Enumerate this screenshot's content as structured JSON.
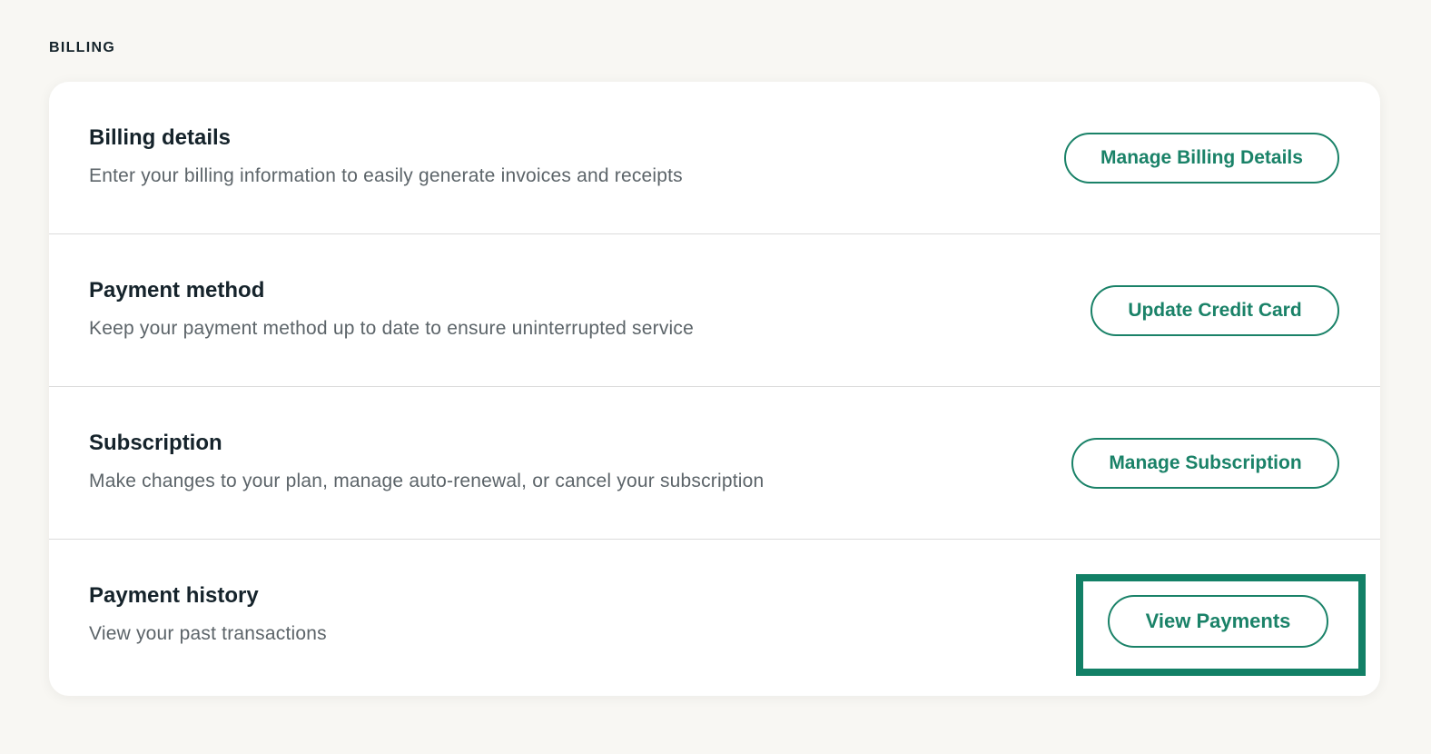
{
  "section": {
    "heading": "BILLING"
  },
  "rows": [
    {
      "title": "Billing details",
      "description": "Enter your billing information to easily generate invoices and receipts",
      "button": "Manage Billing Details"
    },
    {
      "title": "Payment method",
      "description": "Keep your payment method up to date to ensure uninterrupted service",
      "button": "Update Credit Card"
    },
    {
      "title": "Subscription",
      "description": "Make changes to your plan, manage auto-renewal, or cancel your subscription",
      "button": "Manage Subscription"
    },
    {
      "title": "Payment history",
      "description": "View your past transactions",
      "button": "View Payments"
    }
  ],
  "colors": {
    "accent": "#1a8268",
    "highlight": "#128066",
    "background": "#f8f7f3",
    "card": "#ffffff",
    "title_text": "#15232b",
    "description_text": "#5c6469"
  }
}
